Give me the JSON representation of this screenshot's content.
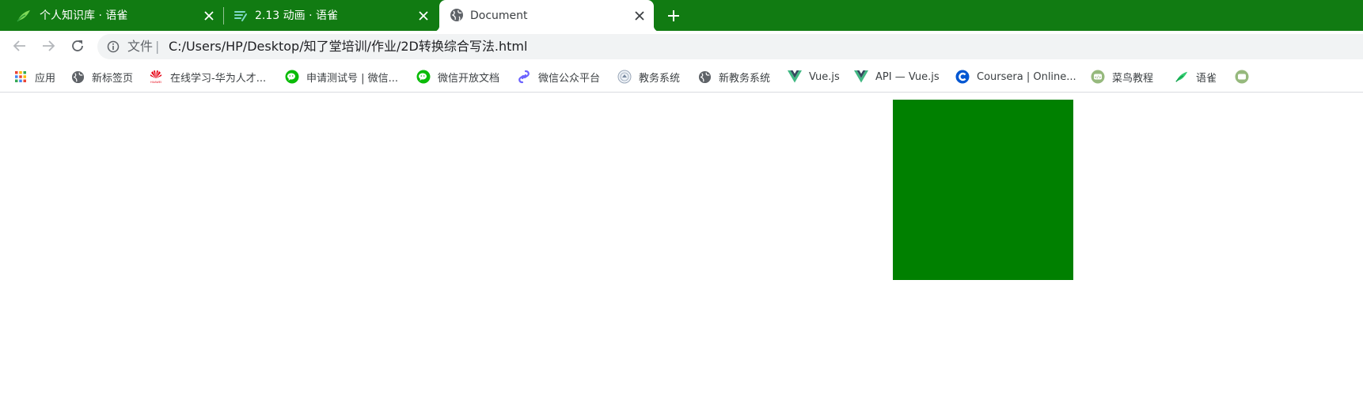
{
  "colors": {
    "tabstrip_bg": "#117b12",
    "box_color": "#008000",
    "url_text": "#202124"
  },
  "tabs": [
    {
      "title": "个人知识库 · 语雀",
      "icon": "yuque-bird-icon",
      "active": false
    },
    {
      "title": "2.13 动画 · 语雀",
      "icon": "yuque-doc-icon",
      "active": false
    },
    {
      "title": "Document",
      "icon": "globe-icon",
      "active": true
    }
  ],
  "toolbar": {
    "scheme_label": "文件",
    "scheme_separator": "|",
    "url": "C:/Users/HP/Desktop/知了堂培训/作业/2D转换综合写法.html"
  },
  "bookmarks": [
    {
      "label": "应用",
      "icon": "apps-grid-icon"
    },
    {
      "label": "新标签页",
      "icon": "globe-icon"
    },
    {
      "label": "在线学习-华为人才...",
      "icon": "huawei-icon"
    },
    {
      "label": "申请测试号 | 微信...",
      "icon": "wechat-icon"
    },
    {
      "label": "微信开放文档",
      "icon": "wechat-icon"
    },
    {
      "label": "微信公众平台",
      "icon": "link-chain-icon"
    },
    {
      "label": "教务系统",
      "icon": "school-seal-icon"
    },
    {
      "label": "新教务系统",
      "icon": "globe-icon"
    },
    {
      "label": "Vue.js",
      "icon": "vue-icon"
    },
    {
      "label": "API — Vue.js",
      "icon": "vue-icon"
    },
    {
      "label": "Coursera | Online...",
      "icon": "coursera-icon"
    },
    {
      "label": "菜鸟教程",
      "icon": "runoob-icon"
    },
    {
      "label": "语雀",
      "icon": "yuque-bird-icon"
    }
  ]
}
